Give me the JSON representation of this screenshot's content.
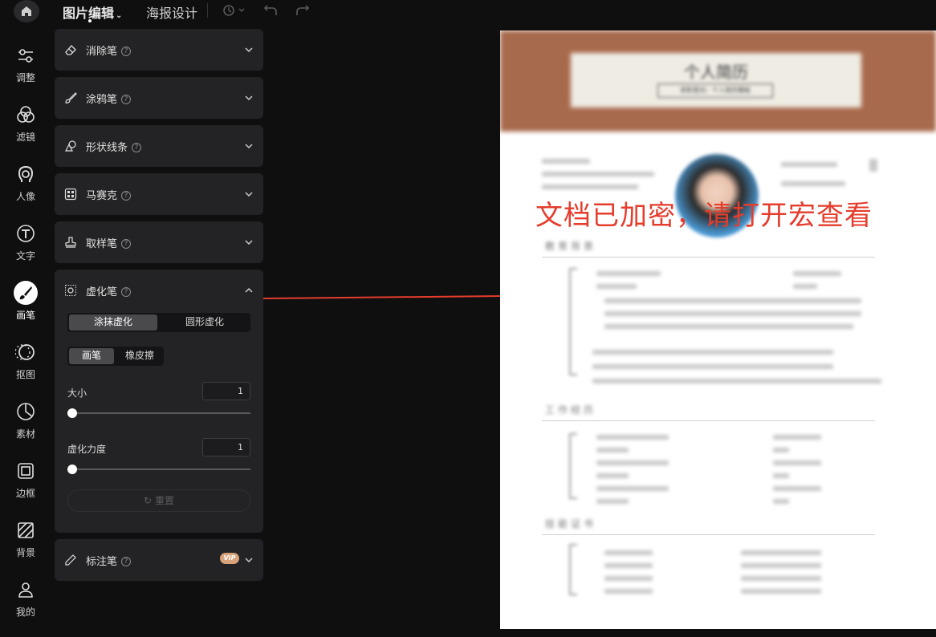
{
  "topbar": {
    "tab_edit": "图片编辑",
    "tab_poster": "海报设计"
  },
  "sidebar": {
    "items": [
      {
        "label": "调整",
        "icon": "sliders-icon"
      },
      {
        "label": "滤镜",
        "icon": "filter-circles-icon"
      },
      {
        "label": "人像",
        "icon": "portrait-icon"
      },
      {
        "label": "文字",
        "icon": "text-icon"
      },
      {
        "label": "画笔",
        "icon": "brush-icon",
        "active": true
      },
      {
        "label": "抠图",
        "icon": "cutout-icon"
      },
      {
        "label": "素材",
        "icon": "sticker-icon"
      },
      {
        "label": "边框",
        "icon": "frame-icon"
      },
      {
        "label": "背景",
        "icon": "background-icon"
      },
      {
        "label": "我的",
        "icon": "user-icon"
      }
    ]
  },
  "tools": {
    "eraser": "消除笔",
    "graffiti": "涂鸦笔",
    "shape": "形状线条",
    "mosaic": "马赛克",
    "sample": "取样笔",
    "blur": "虚化笔",
    "mark": "标注笔",
    "vip_badge": "VIP"
  },
  "blur_panel": {
    "mode_options": [
      "涂抹虚化",
      "圆形虚化"
    ],
    "mode_selected": "涂抹虚化",
    "brush_options": [
      "画笔",
      "橡皮擦"
    ],
    "brush_selected": "画笔",
    "size_label": "大小",
    "size_value": "1",
    "size_fraction": 0,
    "strength_label": "虚化力度",
    "strength_value": "1",
    "strength_fraction": 0,
    "reset_label": "重置"
  },
  "document": {
    "title": "个人简历",
    "subtitle": "求职意向：个人简历模板",
    "watermark": "文档已加密，请打开宏查看"
  },
  "colors": {
    "accent_red": "#e53c2c",
    "header_brown": "#a86a4c",
    "vip_gold": "#d8a27a"
  }
}
